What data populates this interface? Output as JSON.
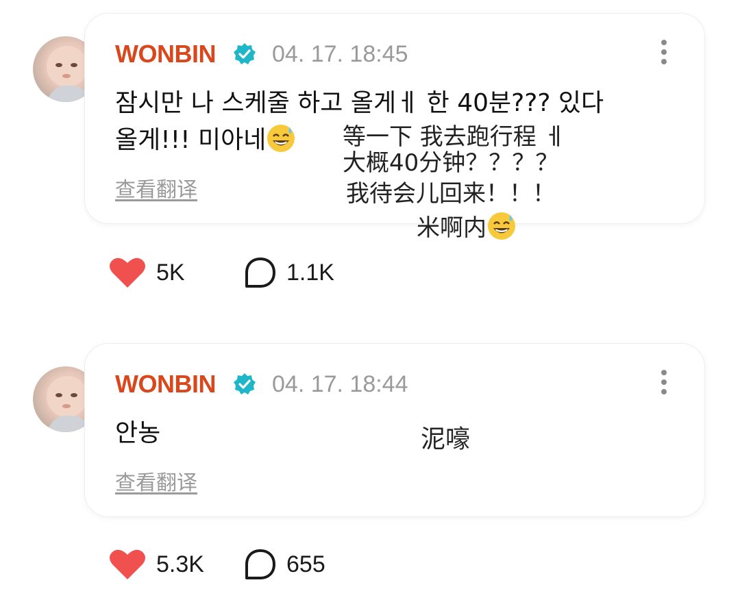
{
  "posts": [
    {
      "author": "WONBIN",
      "timestamp": "04. 17. 18:45",
      "text": "잠시만 나 스케줄 하고 올게ㅔ 한 40분??? 있다\n올게!!! 미아네",
      "translate_label": "查看翻译",
      "handwritten_translation": [
        "等一下 我去跑行程 ㅔ",
        "大概40分钟？？？？",
        "我待会儿回来！！！",
        "米啊内"
      ],
      "likes": "5K",
      "comments": "1.1K"
    },
    {
      "author": "WONBIN",
      "timestamp": "04. 17. 18:44",
      "text": "안농",
      "translate_label": "查看翻译",
      "handwritten_translation": [
        "泥嚎"
      ],
      "likes": "5.3K",
      "comments": "655"
    }
  ],
  "colors": {
    "author": "#d9481c",
    "verified": "#1fb6c9",
    "heart": "#f0504e",
    "muted": "#9a9a9a"
  },
  "icons": [
    "verified-badge-icon",
    "more-options-icon",
    "heart-icon",
    "comment-icon",
    "sweat-smile-emoji-icon"
  ]
}
